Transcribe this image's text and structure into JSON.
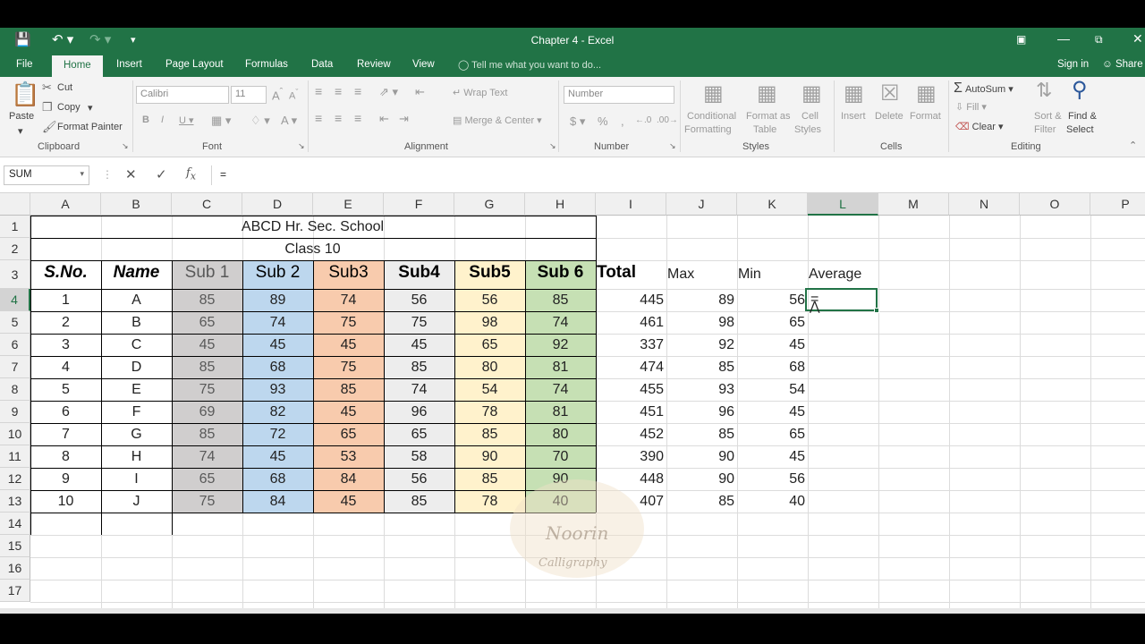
{
  "titlebar": {
    "title": "Chapter 4 - Excel",
    "save_icon": "save-icon",
    "undo_icon": "undo-icon",
    "redo_icon": "redo-icon",
    "customize_icon": "customize-icon"
  },
  "tabs": {
    "file": "File",
    "home": "Home",
    "insert": "Insert",
    "page_layout": "Page Layout",
    "formulas": "Formulas",
    "data": "Data",
    "review": "Review",
    "view": "View",
    "tell_me": "Tell me what you want to do...",
    "sign_in": "Sign in",
    "share": "Share"
  },
  "ribbon": {
    "clipboard": {
      "paste": "Paste",
      "cut": "Cut",
      "copy": "Copy",
      "format_painter": "Format Painter",
      "label": "Clipboard"
    },
    "font": {
      "name": "Calibri",
      "size": "11",
      "label": "Font"
    },
    "alignment": {
      "wrap_text": "Wrap Text",
      "merge_center": "Merge & Center",
      "label": "Alignment"
    },
    "number": {
      "format": "Number",
      "label": "Number"
    },
    "styles": {
      "conditional_1": "Conditional",
      "conditional_2": "Formatting",
      "format_as_1": "Format as",
      "format_as_2": "Table",
      "cell_1": "Cell",
      "cell_2": "Styles",
      "label": "Styles"
    },
    "cells": {
      "insert": "Insert",
      "delete": "Delete",
      "format": "Format",
      "label": "Cells"
    },
    "editing": {
      "autosum": "AutoSum",
      "fill": "Fill",
      "clear": "Clear",
      "sort_1": "Sort &",
      "sort_2": "Filter",
      "find_1": "Find &",
      "find_2": "Select",
      "label": "Editing"
    }
  },
  "formula_bar": {
    "name_box": "SUM",
    "formula": "="
  },
  "columns": [
    "A",
    "B",
    "C",
    "D",
    "E",
    "F",
    "G",
    "H",
    "I",
    "J",
    "K",
    "L",
    "M",
    "N",
    "O",
    "P"
  ],
  "rows": [
    "1",
    "2",
    "3",
    "4",
    "5",
    "6",
    "7",
    "8",
    "9",
    "10",
    "11",
    "12",
    "13",
    "14",
    "15",
    "16",
    "17"
  ],
  "sheet": {
    "school": "ABCD Hr. Sec. School",
    "class": "Class 10",
    "headers": {
      "sno": "S.No.",
      "name": "Name",
      "sub1": "Sub 1",
      "sub2": "Sub 2",
      "sub3": "Sub3",
      "sub4": "Sub4",
      "sub5": "Sub5",
      "sub6": "Sub 6",
      "total": "Total",
      "max": "Max",
      "min": "Min",
      "average": "Average"
    },
    "active_cell_value": "=",
    "records": [
      [
        "1",
        "A",
        "85",
        "89",
        "74",
        "56",
        "56",
        "85",
        "445",
        "89",
        "56"
      ],
      [
        "2",
        "B",
        "65",
        "74",
        "75",
        "75",
        "98",
        "74",
        "461",
        "98",
        "65"
      ],
      [
        "3",
        "C",
        "45",
        "45",
        "45",
        "45",
        "65",
        "92",
        "337",
        "92",
        "45"
      ],
      [
        "4",
        "D",
        "85",
        "68",
        "75",
        "85",
        "80",
        "81",
        "474",
        "85",
        "68"
      ],
      [
        "5",
        "E",
        "75",
        "93",
        "85",
        "74",
        "54",
        "74",
        "455",
        "93",
        "54"
      ],
      [
        "6",
        "F",
        "69",
        "82",
        "45",
        "96",
        "78",
        "81",
        "451",
        "96",
        "45"
      ],
      [
        "7",
        "G",
        "85",
        "72",
        "65",
        "65",
        "85",
        "80",
        "452",
        "85",
        "65"
      ],
      [
        "8",
        "H",
        "74",
        "45",
        "53",
        "58",
        "90",
        "70",
        "390",
        "90",
        "45"
      ],
      [
        "9",
        "I",
        "65",
        "68",
        "84",
        "56",
        "85",
        "90",
        "448",
        "90",
        "56"
      ],
      [
        "10",
        "J",
        "75",
        "84",
        "45",
        "85",
        "78",
        "40",
        "407",
        "85",
        "40"
      ]
    ]
  },
  "colors": {
    "excel_green": "#217346",
    "sub1_fill": "#d0cece",
    "sub2_fill": "#bdd7ee",
    "sub3_fill": "#f8cbad",
    "sub4_fill": "#ededed",
    "sub5_fill": "#fff2cc",
    "sub6_fill": "#c6e0b4"
  },
  "watermark": {
    "line1": "Noorin",
    "line2": "Calligraphy"
  }
}
